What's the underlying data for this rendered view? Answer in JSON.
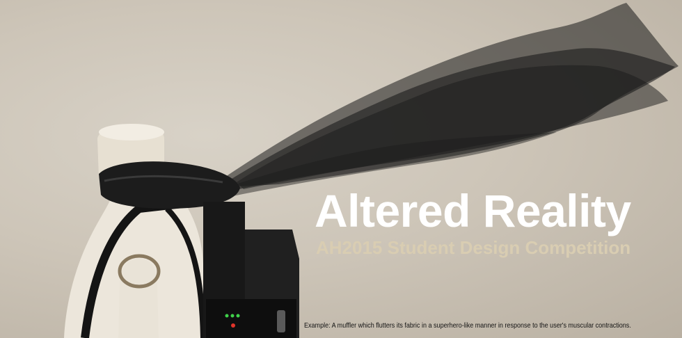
{
  "headline": {
    "title": "Altered Reality",
    "subtitle": "AH2015 Student Design Competition"
  },
  "caption": "Example: A muffler which flutters its fabric in a superhero-like manner in response to the user's muscular contractions.",
  "colors": {
    "background": "#cdc5b8",
    "title": "#ffffff",
    "subtitle": "#d9cdb2",
    "fabric": "#1a1a1a"
  }
}
